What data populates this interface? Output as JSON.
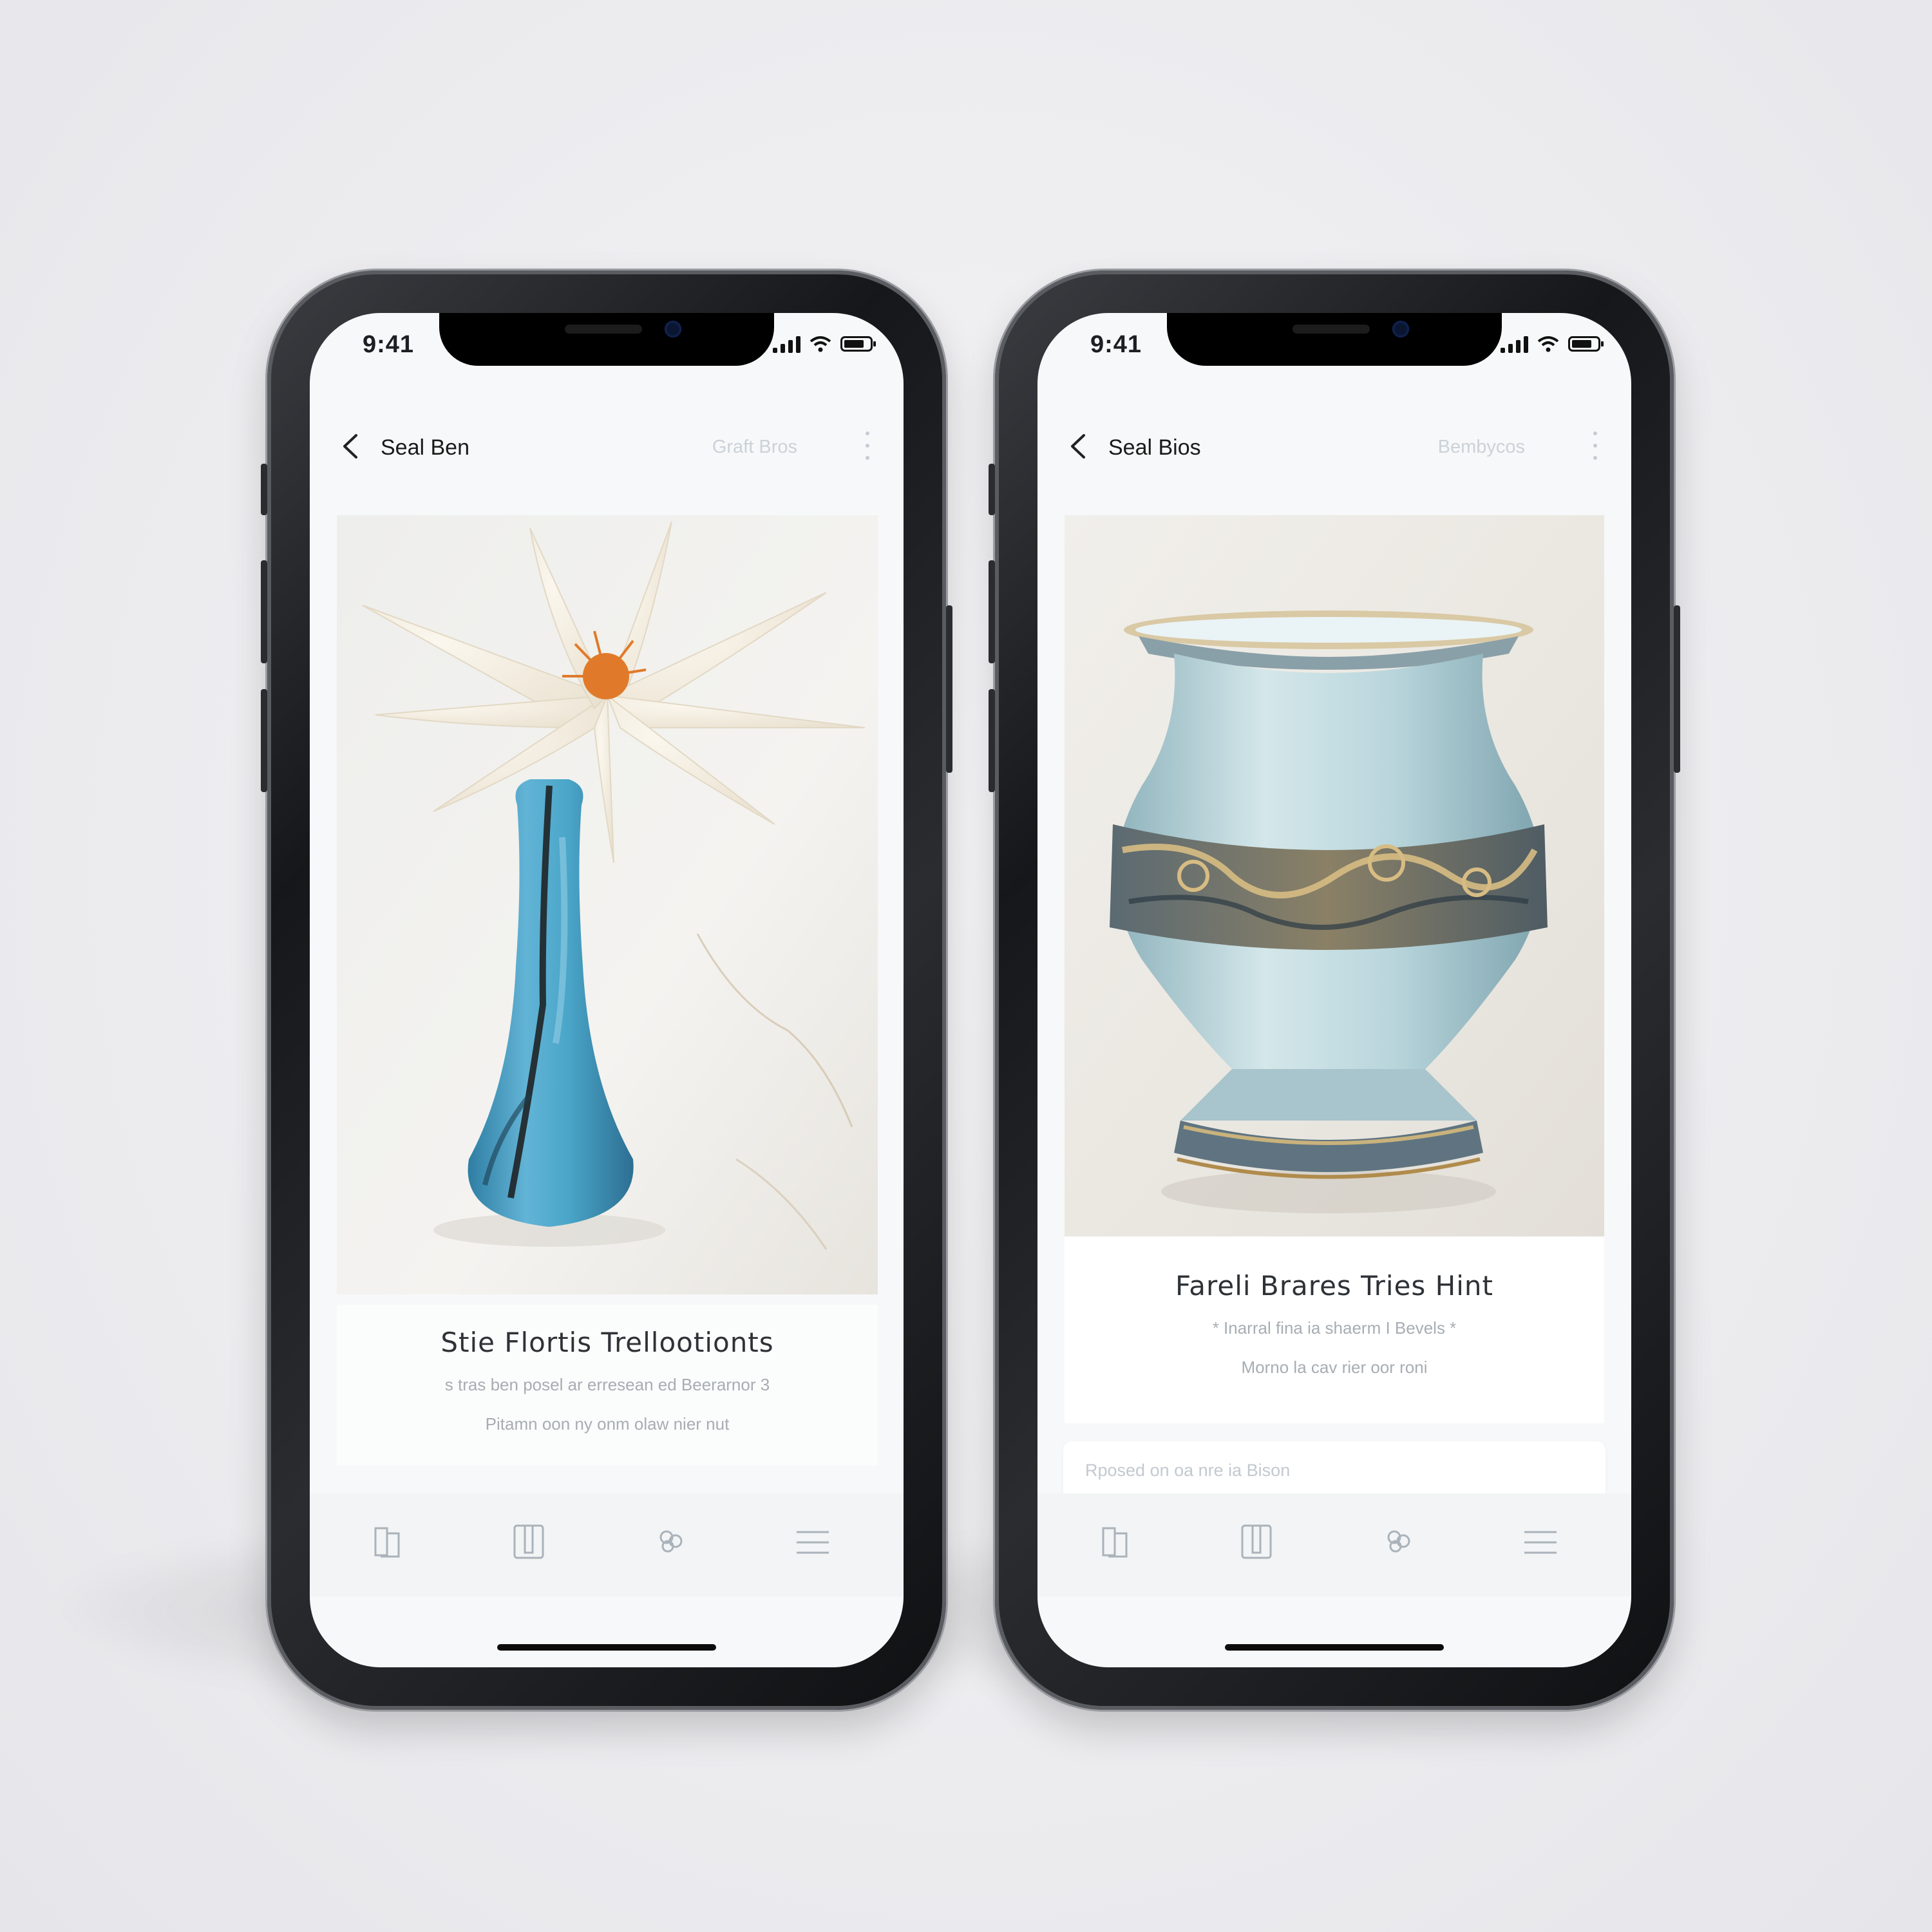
{
  "phones": [
    {
      "status": {
        "time": "9:41"
      },
      "nav": {
        "title": "Seal Ben",
        "action": "Graft Bros"
      },
      "card": {
        "title": "Stie Flortis Trellootionts",
        "line1": "s tras ben posel ar erresean ed Beerarnor 3",
        "line2": "Pitamn oon ny onm olaw nier nut"
      },
      "tabs": [
        "book-icon",
        "bookmark-icon",
        "flower-icon",
        "menu-icon"
      ]
    },
    {
      "status": {
        "time": "9:41"
      },
      "nav": {
        "title": "Seal Bios",
        "action": "Bembycos"
      },
      "card": {
        "title": "Fareli Brares Tries Hint",
        "line1": "* Inarral fina ia shaerm I Bevels *",
        "line2": "Morno la cav rier oor roni"
      },
      "reply_placeholder": "Rposed on oa nre ia Bison",
      "tabs": [
        "book-icon",
        "bookmark-icon",
        "flower-icon",
        "menu-icon"
      ]
    }
  ],
  "colors": {
    "accent_blue": "#4aa6c9",
    "vase_celadon": "#b9d6dc",
    "flower_orange": "#e07a2a"
  }
}
